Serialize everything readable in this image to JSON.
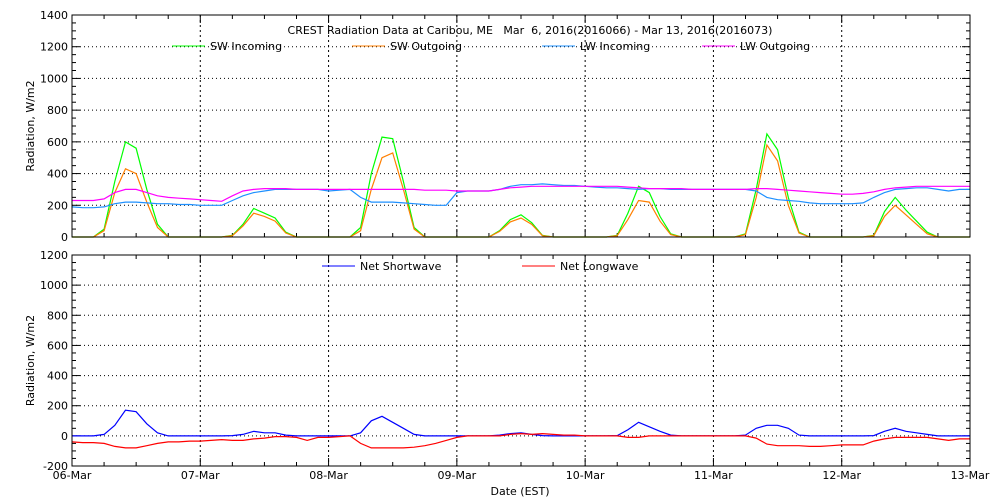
{
  "chart_data": [
    {
      "type": "line",
      "title": "CREST Radiation Data at Caribou, ME   Mar  6, 2016(2016066) - Mar 13, 2016(2016073)",
      "ylabel": "Radiation, W/m2",
      "xlabel": "",
      "ylim": [
        0,
        1400
      ],
      "yticks": [
        "0",
        "200",
        "400",
        "600",
        "800",
        "1000",
        "1200",
        "1400"
      ],
      "x_hours_step": 2,
      "xlim_hours": [
        0,
        168
      ],
      "grid": true,
      "legend_position": "top",
      "series": [
        {
          "name": "SW Incoming",
          "color": "#00ff00",
          "values": [
            0,
            0,
            0,
            50,
            350,
            600,
            560,
            300,
            80,
            0,
            0,
            0,
            0,
            0,
            0,
            10,
            80,
            180,
            150,
            120,
            30,
            0,
            0,
            0,
            0,
            0,
            0,
            60,
            400,
            630,
            620,
            350,
            60,
            0,
            0,
            0,
            0,
            0,
            0,
            0,
            40,
            110,
            140,
            90,
            10,
            0,
            0,
            0,
            0,
            0,
            0,
            10,
            150,
            320,
            280,
            130,
            20,
            0,
            0,
            0,
            0,
            0,
            0,
            20,
            300,
            650,
            550,
            250,
            30,
            0,
            0,
            0,
            0,
            0,
            0,
            10,
            160,
            250,
            170,
            100,
            30,
            0,
            0,
            0,
            0
          ]
        },
        {
          "name": "SW Outgoing",
          "color": "#ff7f00",
          "values": [
            0,
            0,
            0,
            40,
            280,
            430,
            400,
            220,
            60,
            0,
            0,
            0,
            0,
            0,
            0,
            8,
            70,
            150,
            130,
            100,
            25,
            0,
            0,
            0,
            0,
            0,
            0,
            40,
            300,
            500,
            530,
            300,
            50,
            0,
            0,
            0,
            0,
            0,
            0,
            0,
            35,
            95,
            120,
            80,
            8,
            0,
            0,
            0,
            0,
            0,
            0,
            8,
            110,
            230,
            220,
            100,
            15,
            0,
            0,
            0,
            0,
            0,
            0,
            15,
            250,
            580,
            480,
            200,
            25,
            0,
            0,
            0,
            0,
            0,
            0,
            8,
            130,
            200,
            140,
            80,
            20,
            0,
            0,
            0,
            0
          ]
        },
        {
          "name": "LW Incoming",
          "color": "#1e90ff",
          "values": [
            190,
            185,
            185,
            190,
            210,
            220,
            220,
            215,
            210,
            210,
            205,
            205,
            200,
            200,
            200,
            230,
            260,
            280,
            290,
            300,
            300,
            300,
            300,
            300,
            290,
            295,
            300,
            250,
            220,
            220,
            220,
            215,
            210,
            205,
            200,
            200,
            280,
            290,
            290,
            290,
            300,
            320,
            330,
            330,
            335,
            330,
            325,
            325,
            320,
            315,
            310,
            310,
            305,
            300,
            305,
            305,
            300,
            300,
            300,
            300,
            300,
            300,
            300,
            300,
            290,
            250,
            235,
            230,
            225,
            215,
            210,
            210,
            210,
            210,
            215,
            250,
            280,
            300,
            305,
            310,
            310,
            300,
            290,
            300,
            300
          ]
        },
        {
          "name": "LW Outgoing",
          "color": "#ff00ff",
          "values": [
            230,
            230,
            230,
            240,
            280,
            300,
            300,
            280,
            260,
            250,
            245,
            240,
            235,
            230,
            225,
            260,
            290,
            300,
            305,
            305,
            305,
            300,
            300,
            300,
            300,
            300,
            300,
            300,
            300,
            300,
            300,
            300,
            300,
            295,
            295,
            295,
            290,
            290,
            290,
            290,
            300,
            310,
            315,
            320,
            320,
            320,
            320,
            320,
            320,
            320,
            320,
            320,
            315,
            310,
            305,
            305,
            305,
            305,
            300,
            300,
            300,
            300,
            300,
            300,
            305,
            305,
            300,
            295,
            290,
            285,
            280,
            275,
            270,
            270,
            275,
            285,
            300,
            310,
            315,
            320,
            320,
            320,
            320,
            320,
            320
          ]
        }
      ]
    },
    {
      "type": "line",
      "title": "",
      "ylabel": "Radiation, W/m2",
      "xlabel": "Date (EST)",
      "ylim": [
        -200,
        1200
      ],
      "yticks": [
        "-200",
        "0",
        "200",
        "400",
        "600",
        "800",
        "1000",
        "1200"
      ],
      "xticks": [
        "06-Mar",
        "07-Mar",
        "08-Mar",
        "09-Mar",
        "10-Mar",
        "11-Mar",
        "12-Mar",
        "13-Mar"
      ],
      "x_hours_step": 2,
      "xlim_hours": [
        0,
        168
      ],
      "grid": true,
      "legend_position": "top",
      "series": [
        {
          "name": "Net Shortwave",
          "color": "#0000ff",
          "values": [
            0,
            0,
            0,
            10,
            70,
            170,
            160,
            80,
            20,
            0,
            0,
            0,
            0,
            0,
            0,
            2,
            10,
            30,
            20,
            20,
            5,
            0,
            0,
            0,
            0,
            0,
            0,
            20,
            100,
            130,
            90,
            50,
            10,
            0,
            0,
            0,
            0,
            0,
            0,
            0,
            5,
            15,
            20,
            10,
            2,
            0,
            0,
            0,
            0,
            0,
            0,
            2,
            40,
            90,
            60,
            30,
            5,
            0,
            0,
            0,
            0,
            0,
            0,
            5,
            50,
            70,
            70,
            50,
            5,
            0,
            0,
            0,
            0,
            0,
            0,
            2,
            30,
            50,
            30,
            20,
            10,
            0,
            0,
            0,
            0
          ]
        },
        {
          "name": "Net Longwave",
          "color": "#ff0000",
          "values": [
            -40,
            -45,
            -45,
            -50,
            -70,
            -80,
            -80,
            -65,
            -50,
            -40,
            -40,
            -35,
            -35,
            -30,
            -25,
            -30,
            -30,
            -20,
            -15,
            -5,
            -5,
            -10,
            -30,
            -10,
            -10,
            -5,
            0,
            -50,
            -80,
            -80,
            -80,
            -80,
            -75,
            -65,
            -50,
            -30,
            -10,
            0,
            0,
            0,
            0,
            10,
            15,
            10,
            15,
            10,
            5,
            5,
            0,
            0,
            0,
            0,
            -10,
            -10,
            0,
            0,
            0,
            0,
            0,
            0,
            0,
            0,
            0,
            0,
            -15,
            -55,
            -65,
            -65,
            -65,
            -70,
            -70,
            -65,
            -60,
            -60,
            -60,
            -35,
            -20,
            -10,
            -10,
            -10,
            -10,
            -20,
            -30,
            -20,
            -20
          ]
        }
      ]
    }
  ]
}
